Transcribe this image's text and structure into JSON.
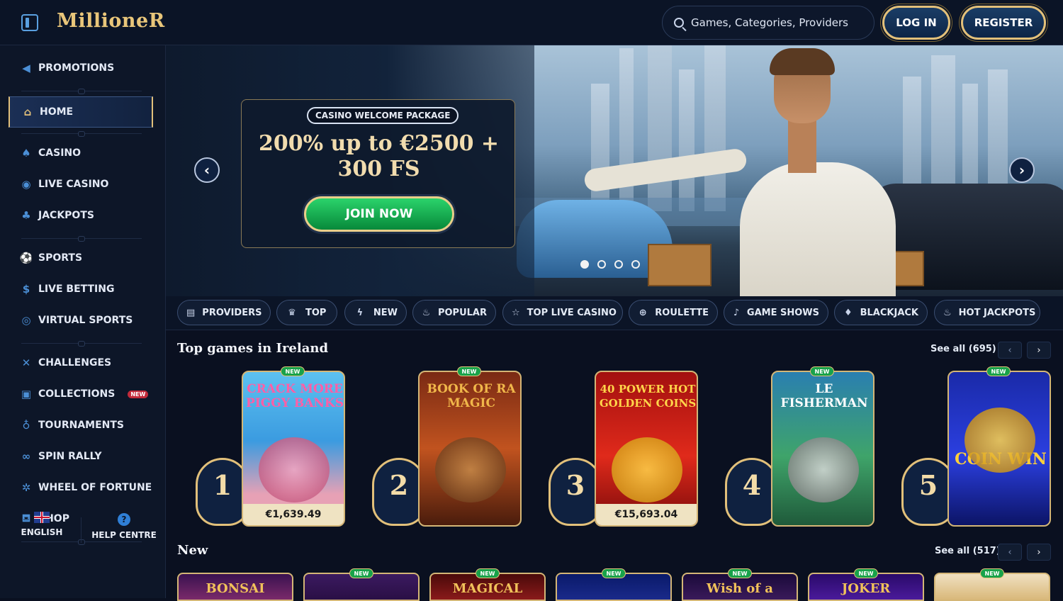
{
  "header": {
    "logo": "MillioneR",
    "search_placeholder": "Games, Categories, Providers",
    "login": "LOG IN",
    "register": "REGISTER"
  },
  "sidebar": {
    "items": [
      {
        "label": "PROMOTIONS",
        "icon": "megaphone-icon"
      },
      {
        "label": "HOME",
        "icon": "home-icon"
      },
      {
        "label": "CASINO",
        "icon": "spade-icon"
      },
      {
        "label": "LIVE CASINO",
        "icon": "chip-icon"
      },
      {
        "label": "JACKPOTS",
        "icon": "clover-icon"
      },
      {
        "label": "SPORTS",
        "icon": "ball-icon"
      },
      {
        "label": "LIVE BETTING",
        "icon": "coin-icon"
      },
      {
        "label": "VIRTUAL SPORTS",
        "icon": "globe-icon"
      },
      {
        "label": "CHALLENGES",
        "icon": "swords-icon"
      },
      {
        "label": "COLLECTIONS",
        "icon": "cards-icon"
      },
      {
        "label": "TOURNAMENTS",
        "icon": "medal-icon"
      },
      {
        "label": "SPIN RALLY",
        "icon": "rally-icon"
      },
      {
        "label": "WHEEL OF FORTUNE",
        "icon": "wheel-icon"
      },
      {
        "label": "SHOP",
        "icon": "basket-icon"
      }
    ],
    "collections_badge": "NEW",
    "language": "ENGLISH",
    "help": "HELP CENTRE"
  },
  "hero": {
    "tag": "CASINO WELCOME PACKAGE",
    "title_line1": "200% up to €2500 +",
    "title_line2": "300 FS",
    "cta": "JOIN NOW",
    "prev": "‹",
    "next": "›",
    "slide_count": 4,
    "active_slide": 1
  },
  "categories": [
    "PROVIDERS",
    "TOP",
    "NEW",
    "POPULAR",
    "TOP LIVE CASINO",
    "ROULETTE",
    "GAME SHOWS",
    "BLACKJACK",
    "HOT JACKPOTS"
  ],
  "top_games": {
    "title": "Top games in Ireland",
    "see_all": "See all (695)",
    "prev": "‹",
    "next": "›",
    "games": [
      {
        "rank": "1",
        "name": "CRACK MORE PIGGY BANKS",
        "new": "NEW",
        "price": "€1,639.49"
      },
      {
        "rank": "2",
        "name": "BOOK OF RA MAGIC",
        "new": "NEW",
        "price": ""
      },
      {
        "rank": "3",
        "name": "40 POWER HOT GOLDEN COINS",
        "new": "",
        "price": "€15,693.04"
      },
      {
        "rank": "4",
        "name": "LE FISHERMAN",
        "new": "NEW",
        "price": ""
      },
      {
        "rank": "5",
        "name": "COIN WIN",
        "new": "NEW",
        "price": ""
      }
    ]
  },
  "new_games": {
    "title": "New",
    "see_all": "See all (517)",
    "prev": "‹",
    "next": "›",
    "games": [
      {
        "name": "BONSAI",
        "new": ""
      },
      {
        "name": "",
        "new": "NEW"
      },
      {
        "name": "MAGICAL",
        "new": "NEW"
      },
      {
        "name": "",
        "new": "NEW"
      },
      {
        "name": "Wish of a",
        "new": "NEW"
      },
      {
        "name": "JOKER",
        "new": "NEW"
      },
      {
        "name": "",
        "new": "NEW"
      }
    ]
  }
}
